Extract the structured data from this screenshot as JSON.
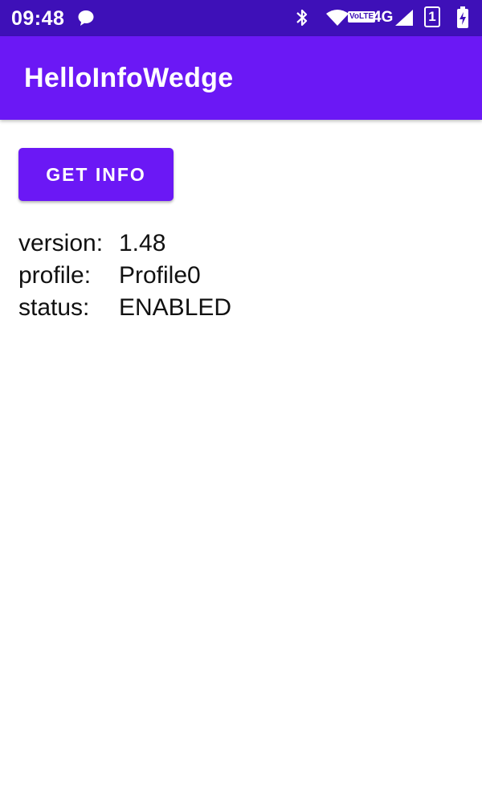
{
  "status_bar": {
    "time": "09:48",
    "volte": "VoLTE",
    "network": "4G",
    "sim_slot": "1",
    "icons": [
      "chat-bubble-icon",
      "bluetooth-icon",
      "wifi-icon",
      "signal-icon",
      "battery-charging-icon"
    ]
  },
  "app_bar": {
    "title": "HelloInfoWedge"
  },
  "main": {
    "button_label": "GET INFO",
    "info": [
      {
        "label": "version:",
        "value": "1.48"
      },
      {
        "label": "profile:",
        "value": "Profile0"
      },
      {
        "label": "status:",
        "value": "ENABLED"
      }
    ]
  },
  "colors": {
    "status_bar": "#3e10b8",
    "primary": "#6b18f5",
    "background": "#ffffff"
  }
}
